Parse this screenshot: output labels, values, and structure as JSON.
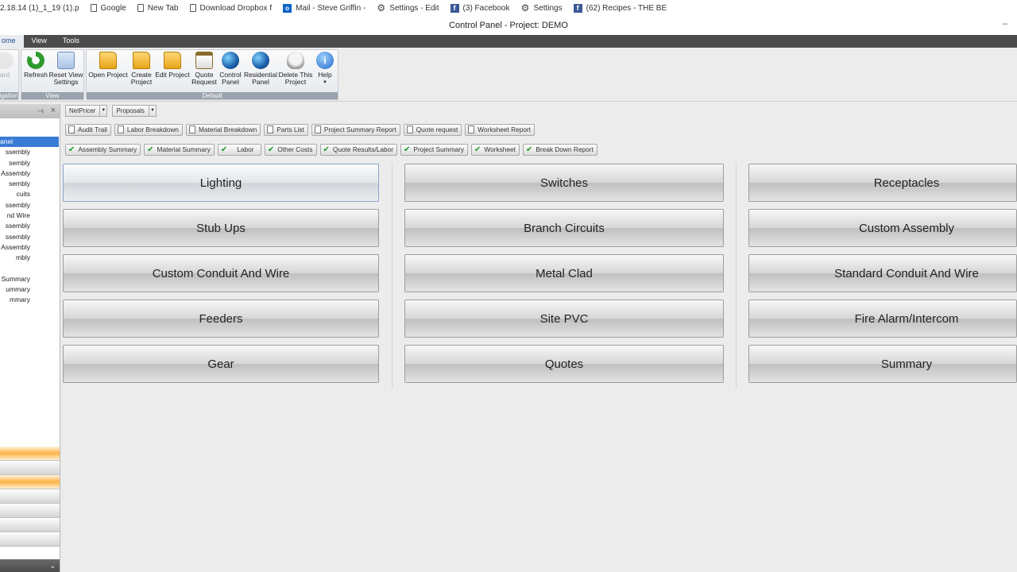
{
  "bookmarks": [
    {
      "label": "2.18.14 (1)_1_19 (1).p",
      "icon": "doc-icon"
    },
    {
      "label": "Google",
      "icon": "doc-icon"
    },
    {
      "label": "New Tab",
      "icon": "doc-icon"
    },
    {
      "label": "Download Dropbox f",
      "icon": "doc-icon"
    },
    {
      "label": "Mail - Steve Griffin - ",
      "icon": "outlook-icon"
    },
    {
      "label": "Settings - Edit",
      "icon": "gear-icon"
    },
    {
      "label": "(3) Facebook",
      "icon": "facebook-icon"
    },
    {
      "label": "Settings",
      "icon": "gear-icon"
    },
    {
      "label": "(62) Recipes - THE BE",
      "icon": "facebook-icon"
    }
  ],
  "window": {
    "title": "Control Panel -  Project: DEMO",
    "minimize": "–"
  },
  "ribbon_tabs": [
    "ome",
    "View",
    "Tools"
  ],
  "ribbon": {
    "groups": {
      "navigation": "igation",
      "view": "View",
      "default": "Default"
    },
    "buttons": {
      "nav": "ard",
      "refresh": "Refresh",
      "reset_view_1": "Reset View",
      "reset_view_2": "Settings",
      "open_project_1": "Open Project",
      "create_project_1": "Create",
      "create_project_2": "Project",
      "edit_project_1": "Edit Project",
      "quote_request_1": "Quote",
      "quote_request_2": "Request",
      "control_panel_1": "Control",
      "control_panel_2": "Panel",
      "residential_panel_1": "Residential",
      "residential_panel_2": "Panel",
      "delete_project_1": "Delete This",
      "delete_project_2": "Project",
      "help_1": "Help"
    }
  },
  "left_panel": {
    "pin": "⊣",
    "close": "×",
    "items": [
      "anel",
      "ssembly",
      "sembly",
      "e Assembly",
      "sembly",
      "cuits",
      "ssembly",
      "nd Wire",
      "ssembly",
      "ssembly",
      " Assembly",
      "mbly",
      "",
      "Summary",
      "ummary",
      "mmary"
    ],
    "scroll": "⌄"
  },
  "combos": {
    "netpricer": "NetPricer",
    "proposals": "Proposals"
  },
  "report_buttons": [
    "Audit Trail",
    "Labor Breakdown",
    "Material Breakdown",
    "Parts List",
    "Project Summary Report",
    "Quote request",
    "Worksheet Report"
  ],
  "check_buttons": [
    "Assembly Summary",
    "Material Summary",
    "Labor",
    "Other Costs",
    "Quote Results/Labor",
    "Project Summary",
    "Worksheet",
    "Break Down Report"
  ],
  "grid": [
    [
      "Lighting",
      "Switches",
      "Receptacles"
    ],
    [
      "Stub Ups",
      "Branch Circuits",
      "Custom Assembly"
    ],
    [
      "Custom Conduit And Wire",
      "Metal Clad",
      "Standard Conduit And Wire"
    ],
    [
      "Feeders",
      "Site PVC",
      "Fire Alarm/Intercom"
    ],
    [
      "Gear",
      "Quotes",
      "Summary"
    ]
  ]
}
